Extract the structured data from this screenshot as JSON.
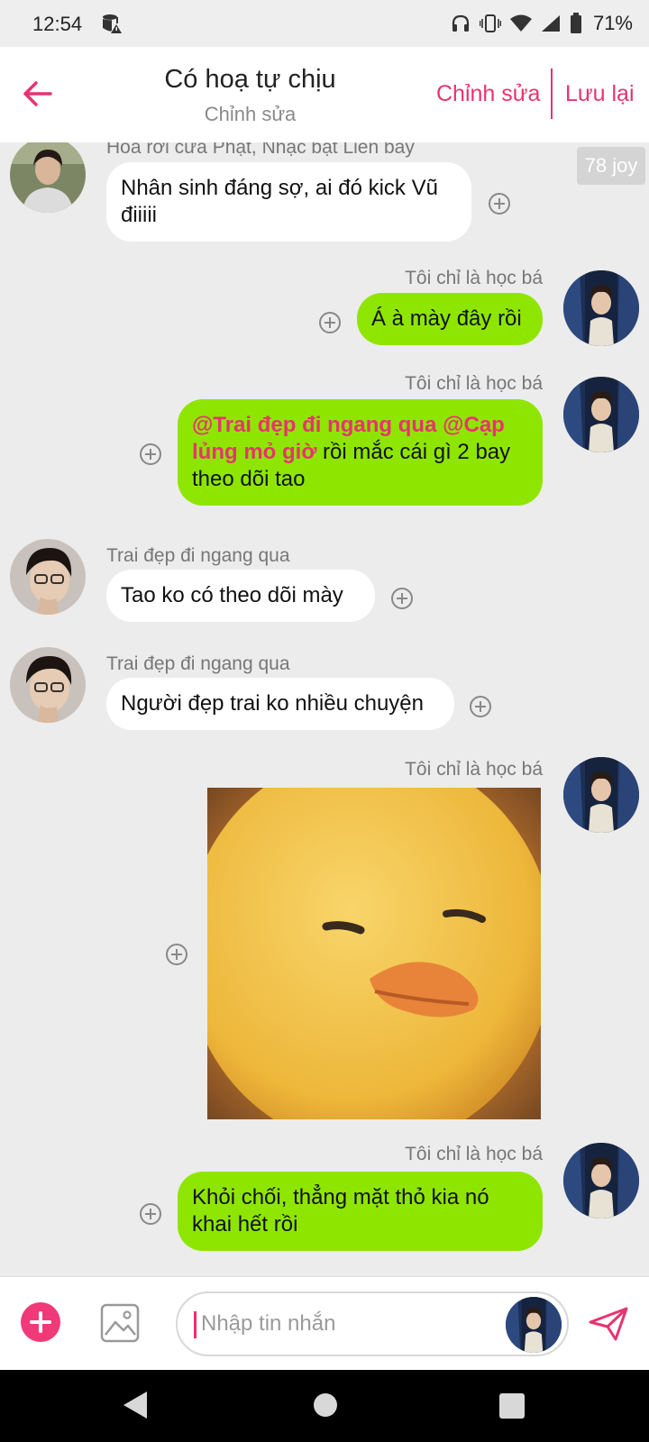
{
  "status_bar": {
    "time": "12:54",
    "battery": "71%"
  },
  "header": {
    "title": "Có hoạ tự chịu",
    "subtitle": "Chỉnh sửa",
    "edit_label": "Chỉnh sửa",
    "save_label": "Lưu lại"
  },
  "badge": {
    "joy": "78 joy"
  },
  "messages": [
    {
      "sender": "Hoa rơi cửa Phật, Nhạc bật Liên bay",
      "text": "Nhân sinh đáng sợ, ai đó kick Vũ điiiii"
    },
    {
      "sender": "Tôi chỉ là học bá",
      "text": "Á à mày đây rồi"
    },
    {
      "sender": "Tôi chỉ là học bá",
      "mention1": "@Trai đẹp đi ngang qua",
      "mention2": "@Cạp lủng mỏ giờ",
      "text": " rồi mắc cái gì 2 bay theo dõi tao"
    },
    {
      "sender": "Trai đẹp đi ngang qua",
      "text": "Tao ko có theo dõi mày"
    },
    {
      "sender": "Trai đẹp đi ngang qua",
      "text": "Người đẹp trai ko nhiều chuyện"
    },
    {
      "sender": "Tôi chỉ là học bá",
      "image": "yellow-duck-meme"
    },
    {
      "sender": "Tôi chỉ là học bá",
      "text": "Khỏi chối, thẳng mặt thỏ kia nó khai hết rồi"
    }
  ],
  "input": {
    "placeholder": "Nhập tin nhắn"
  },
  "colors": {
    "accent": "#e8336e",
    "outgoing_bubble": "#8ee600",
    "incoming_bubble": "#ffffff",
    "background": "#ececec"
  }
}
